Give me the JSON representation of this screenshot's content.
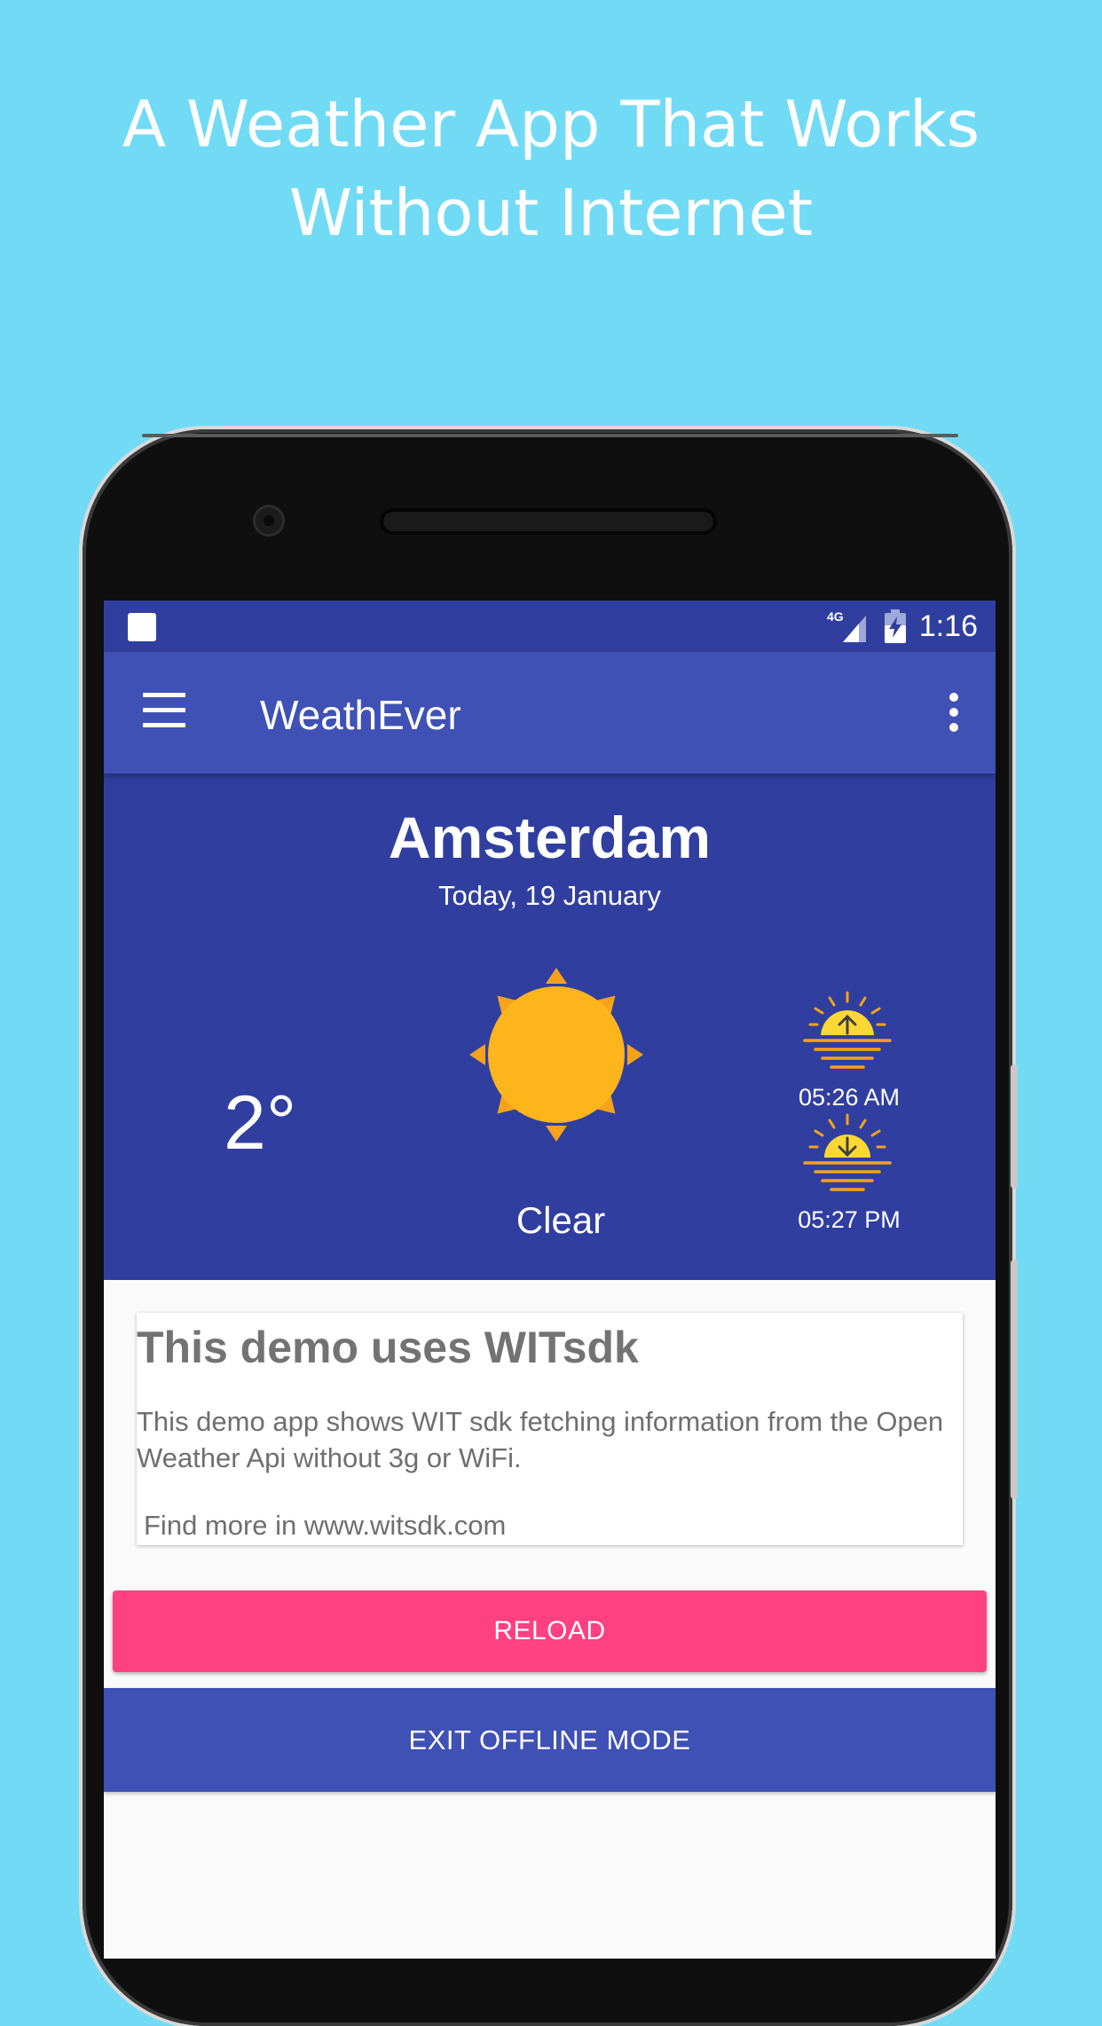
{
  "promo": {
    "headline_line1": "A Weather App That Works",
    "headline_line2": "Without Internet"
  },
  "status_bar": {
    "network": "4G",
    "time": "1:16"
  },
  "app_bar": {
    "title": "WeathEver",
    "menu_icon": "hamburger-menu-icon",
    "overflow_icon": "more-vert-icon"
  },
  "weather": {
    "city": "Amsterdam",
    "date": "Today, 19 January",
    "temperature": "2°",
    "condition": "Clear",
    "condition_icon": "sun-icon",
    "sunrise_time": "05:26 AM",
    "sunset_time": "05:27 PM"
  },
  "info_card": {
    "title": "This demo uses WITsdk",
    "body": "This demo app shows WIT sdk fetching information from the Open Weather Api without 3g or WiFi.",
    "link_text": "Find more in www.witsdk.com"
  },
  "buttons": {
    "reload": "RELOAD",
    "exit_offline": "EXIT OFFLINE MODE"
  },
  "colors": {
    "background": "#71dbf5",
    "primary": "#3f51b5",
    "primary_dark": "#303f9f",
    "accent": "#ff4081",
    "sun": "#fdb51c"
  }
}
